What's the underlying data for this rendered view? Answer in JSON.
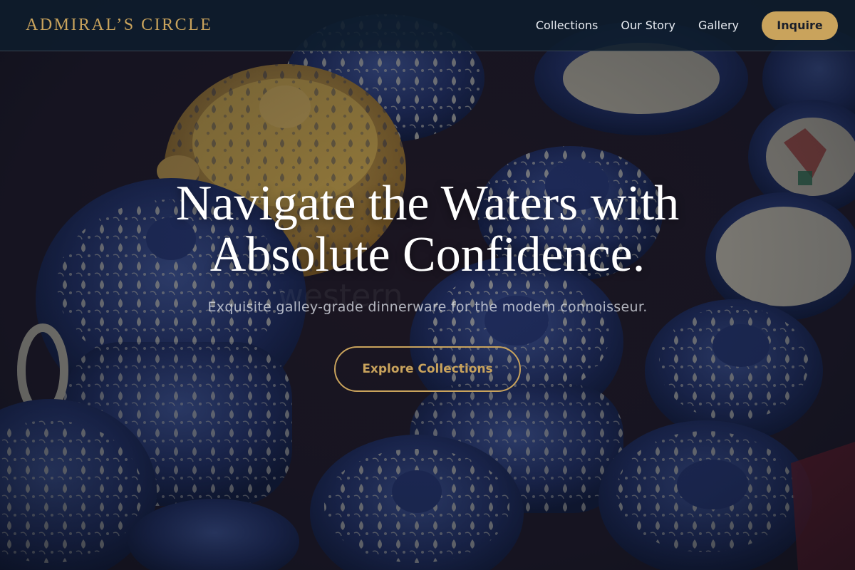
{
  "header": {
    "brand": "ADMIRAL’S CIRCLE",
    "nav": [
      {
        "label": "Collections"
      },
      {
        "label": "Our Story"
      },
      {
        "label": "Gallery"
      }
    ],
    "cta_label": "Inquire"
  },
  "hero": {
    "title_line1": "Navigate the Waters with",
    "title_line2": "Absolute Confidence.",
    "subtitle": "Exquisite galley-grade dinnerware for the modern connoisseur.",
    "cta_label": "Explore Collections",
    "background_image": "blue-pottery-ceramics-photo"
  },
  "colors": {
    "accent": "#c9a35c",
    "header_bg": "#0e1c2c",
    "text_light": "#ffffff"
  }
}
